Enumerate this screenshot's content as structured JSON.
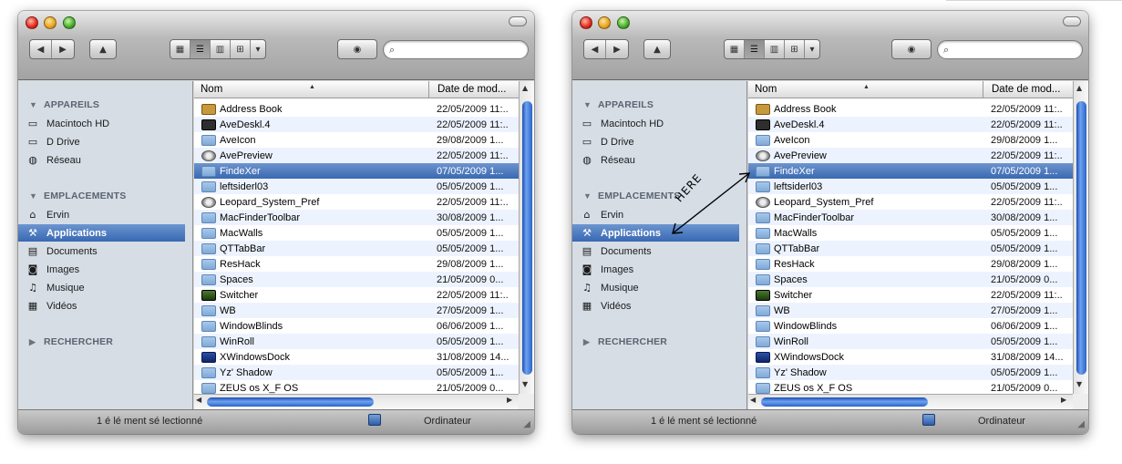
{
  "sidebar": {
    "devices_header": "APPAREILS",
    "places_header": "EMPLACEMENTS",
    "search_header": "RECHERCHER",
    "devices": [
      {
        "label": "Macintoch HD",
        "icon": "hard-drive-icon"
      },
      {
        "label": "D Drive",
        "icon": "hard-drive-icon"
      },
      {
        "label": "Réseau",
        "icon": "network-icon"
      }
    ],
    "places": [
      {
        "label": "Ervin",
        "icon": "home-icon"
      },
      {
        "label": "Applications",
        "icon": "applications-icon"
      },
      {
        "label": "Documents",
        "icon": "documents-icon"
      },
      {
        "label": "Images",
        "icon": "camera-icon"
      },
      {
        "label": "Musique",
        "icon": "music-note-icon"
      },
      {
        "label": "Vidéos",
        "icon": "film-icon"
      }
    ],
    "selected": "Applications"
  },
  "columns": {
    "name": "Nom",
    "date": "Date de mod..."
  },
  "files": [
    {
      "name": "Address Book",
      "date": "22/05/2009 11:..",
      "icon": "book"
    },
    {
      "name": "AveDeskl.4",
      "date": "22/05/2009 11:..",
      "icon": "dark"
    },
    {
      "name": "AveIcon",
      "date": "29/08/2009 1...",
      "icon": "folder"
    },
    {
      "name": "AvePreview",
      "date": "22/05/2009 11:..",
      "icon": "gear"
    },
    {
      "name": "FindeXer",
      "date": "07/05/2009 1...",
      "icon": "folder"
    },
    {
      "name": "leftsiderl03",
      "date": "05/05/2009 1...",
      "icon": "folder"
    },
    {
      "name": "Leopard_System_Pref",
      "date": "22/05/2009 11:..",
      "icon": "gear"
    },
    {
      "name": "MacFinderToolbar",
      "date": "30/08/2009 1...",
      "icon": "folder"
    },
    {
      "name": "MacWalls",
      "date": "05/05/2009 1...",
      "icon": "folder"
    },
    {
      "name": "QTTabBar",
      "date": "05/05/2009 1...",
      "icon": "folder"
    },
    {
      "name": "ResHack",
      "date": "29/08/2009 1...",
      "icon": "folder"
    },
    {
      "name": "Spaces",
      "date": "21/05/2009 0...",
      "icon": "folder"
    },
    {
      "name": "Switcher",
      "date": "22/05/2009 11:..",
      "icon": "app"
    },
    {
      "name": "WB",
      "date": "27/05/2009 1...",
      "icon": "folder"
    },
    {
      "name": "WindowBlinds",
      "date": "06/06/2009 1...",
      "icon": "folder"
    },
    {
      "name": "WinRoll",
      "date": "05/05/2009 1...",
      "icon": "folder"
    },
    {
      "name": "XWindowsDock",
      "date": "31/08/2009 14...",
      "icon": "blue"
    },
    {
      "name": "Yz' Shadow",
      "date": "05/05/2009 1...",
      "icon": "folder"
    },
    {
      "name": "ZEUS os X_F OS",
      "date": "21/05/2009 0...",
      "icon": "folder"
    }
  ],
  "selected_file": "FindeXer",
  "statusbar": {
    "status": "1 é lé ment sé lectionné",
    "computer": "Ordinateur"
  },
  "annotation": {
    "label": "HERE"
  },
  "colors": {
    "selection": "#3868b3",
    "sidebar_bg": "#d6dde5",
    "row_alt": "#edf3fe"
  }
}
